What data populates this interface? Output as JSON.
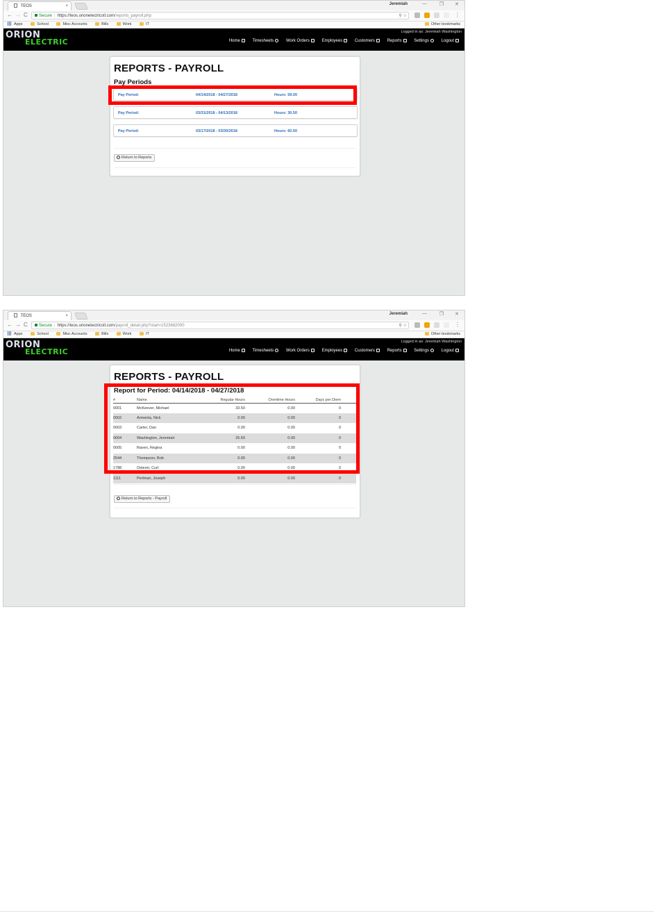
{
  "browser": {
    "tab_title": "TEOS",
    "tab_close": "×",
    "user": "Jeremiah",
    "win_min": "—",
    "win_max": "❐",
    "win_close": "✕",
    "nav_back": "←",
    "nav_forward": "→",
    "nav_reload": "C",
    "secure_label": "Secure",
    "host": "https://teos.orionelectricstl.com",
    "path_1": "/reports_payroll.php",
    "path_2": "/payroll_detail.php?start=1523682000",
    "omni_icons": "⚲ ☆",
    "menu_dots": "⋮"
  },
  "bookmarks": [
    {
      "label": "Apps",
      "icon": "apps-icon"
    },
    {
      "label": "School",
      "icon": "folder-icon"
    },
    {
      "label": "Misc Accounts",
      "icon": "folder-icon"
    },
    {
      "label": "Bills",
      "icon": "folder-icon"
    },
    {
      "label": "Work",
      "icon": "folder-icon"
    },
    {
      "label": "IT",
      "icon": "folder-icon"
    }
  ],
  "other_bookmarks": "Other bookmarks",
  "app": {
    "logo_top": "ORION",
    "logo_bottom": "ELECTRIC",
    "logged_in": "Logged in as: Jeremiah Washington",
    "nav": [
      "Home",
      "Timesheets",
      "Work Orders",
      "Employees",
      "Customers",
      "Reports",
      "Settings",
      "Logout"
    ]
  },
  "page1": {
    "title": "REPORTS - PAYROLL",
    "subtitle": "Pay Periods",
    "periods": [
      {
        "label": "Pay Period:",
        "range": "04/14/2018 - 04/27/2018",
        "hours": "Hours: 59.00"
      },
      {
        "label": "Pay Period:",
        "range": "03/31/2018 - 04/13/2018",
        "hours": "Hours: 30.50"
      },
      {
        "label": "Pay Period:",
        "range": "03/17/2018 - 03/30/2018",
        "hours": "Hours: 60.50"
      }
    ],
    "button": "Return to Reports"
  },
  "page2": {
    "title": "REPORTS - PAYROLL",
    "subtitle": "Report for Period: 04/14/2018 - 04/27/2018",
    "columns": [
      "#",
      "Name",
      "Regular Hours",
      "Overtime Hours",
      "Days per Diem"
    ],
    "rows": [
      [
        "0001",
        "McKeever, Michael",
        "33.50",
        "0.00",
        "0"
      ],
      [
        "0002",
        "Armenta, Nick",
        "0.00",
        "0.00",
        "0"
      ],
      [
        "0003",
        "Carter, Dan",
        "0.00",
        "0.00",
        "0"
      ],
      [
        "0004",
        "Washington, Jeremiah",
        "25.50",
        "0.00",
        "0"
      ],
      [
        "0005",
        "Raven, Regina",
        "0.00",
        "0.00",
        "0"
      ],
      [
        "2544",
        "Thompson, Bob",
        "0.00",
        "0.00",
        "0"
      ],
      [
        "1788",
        "Osterer, Curt",
        "0.00",
        "0.00",
        "0"
      ],
      [
        "1111",
        "Perlman, Joseph",
        "0.00",
        "0.00",
        "0"
      ]
    ],
    "button": "Return to Reports - Payroll"
  },
  "colors": {
    "highlight": "#ff0000",
    "link": "#2a6ebb",
    "logo_green": "#3dcf28",
    "navbar": "#000000"
  }
}
